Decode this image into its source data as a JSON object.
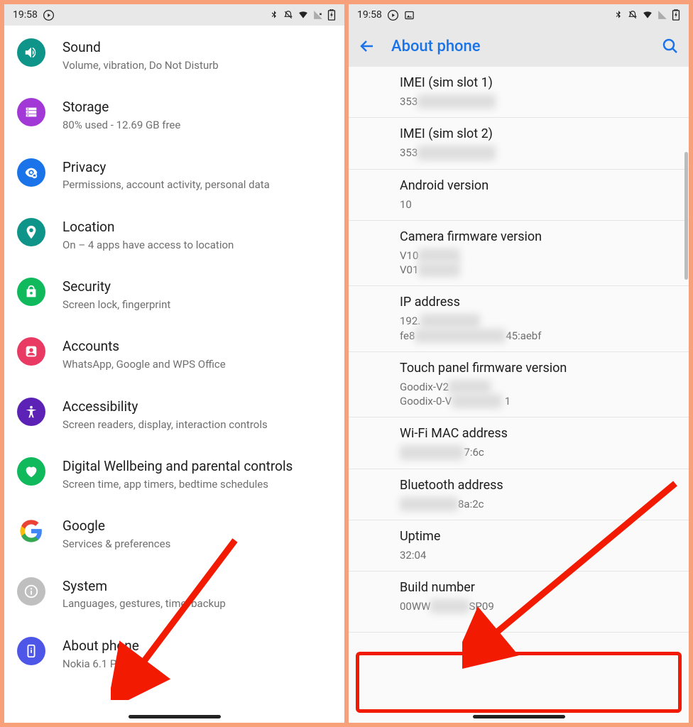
{
  "statusbar": {
    "time": "19:58",
    "icons_right_text": "✶ ⊘ ▾ ⨯ ◫"
  },
  "left": {
    "items": [
      {
        "title": "Sound",
        "sub": "Volume, vibration, Do Not Disturb"
      },
      {
        "title": "Storage",
        "sub": "80% used - 12.69 GB free"
      },
      {
        "title": "Privacy",
        "sub": "Permissions, account activity, personal data"
      },
      {
        "title": "Location",
        "sub": "On – 4 apps have access to location"
      },
      {
        "title": "Security",
        "sub": "Screen lock, fingerprint"
      },
      {
        "title": "Accounts",
        "sub": "WhatsApp, Google and WPS Office"
      },
      {
        "title": "Accessibility",
        "sub": "Screen readers, display, interaction controls"
      },
      {
        "title": "Digital Wellbeing and parental controls",
        "sub": "Screen time, app timers, bedtime schedules"
      },
      {
        "title": "Google",
        "sub": "Services & preferences"
      },
      {
        "title": "System",
        "sub": "Languages, gestures, time, backup"
      },
      {
        "title": "About phone",
        "sub": "Nokia 6.1 Plus"
      }
    ]
  },
  "right": {
    "appbar_title": "About phone",
    "sections": {
      "imei1_label": "IMEI (sim slot 1)",
      "imei1_prefix": "353",
      "imei2_label": "IMEI (sim slot 2)",
      "imei2_prefix": "353",
      "android_label": "Android version",
      "android_value": "10",
      "camfw_label": "Camera firmware version",
      "camfw_v1": "V10",
      "camfw_v2": "V01",
      "ip_label": "IP address",
      "ip_v1": "192.",
      "ip_v2a": "fe8",
      "ip_v2b": "45:aebf",
      "touch_label": "Touch panel firmware version",
      "touch_v1": "Goodix-V2",
      "touch_v2a": "Goodix-0-V",
      "touch_v2b": "1",
      "wifi_label": "Wi-Fi MAC address",
      "wifi_suffix": "7:6c",
      "bt_label": "Bluetooth address",
      "bt_suffix": "8a:2c",
      "uptime_label": "Uptime",
      "uptime_value": "32:04",
      "build_label": "Build number",
      "build_prefix": "00WW",
      "build_suffix": "SP09"
    }
  }
}
